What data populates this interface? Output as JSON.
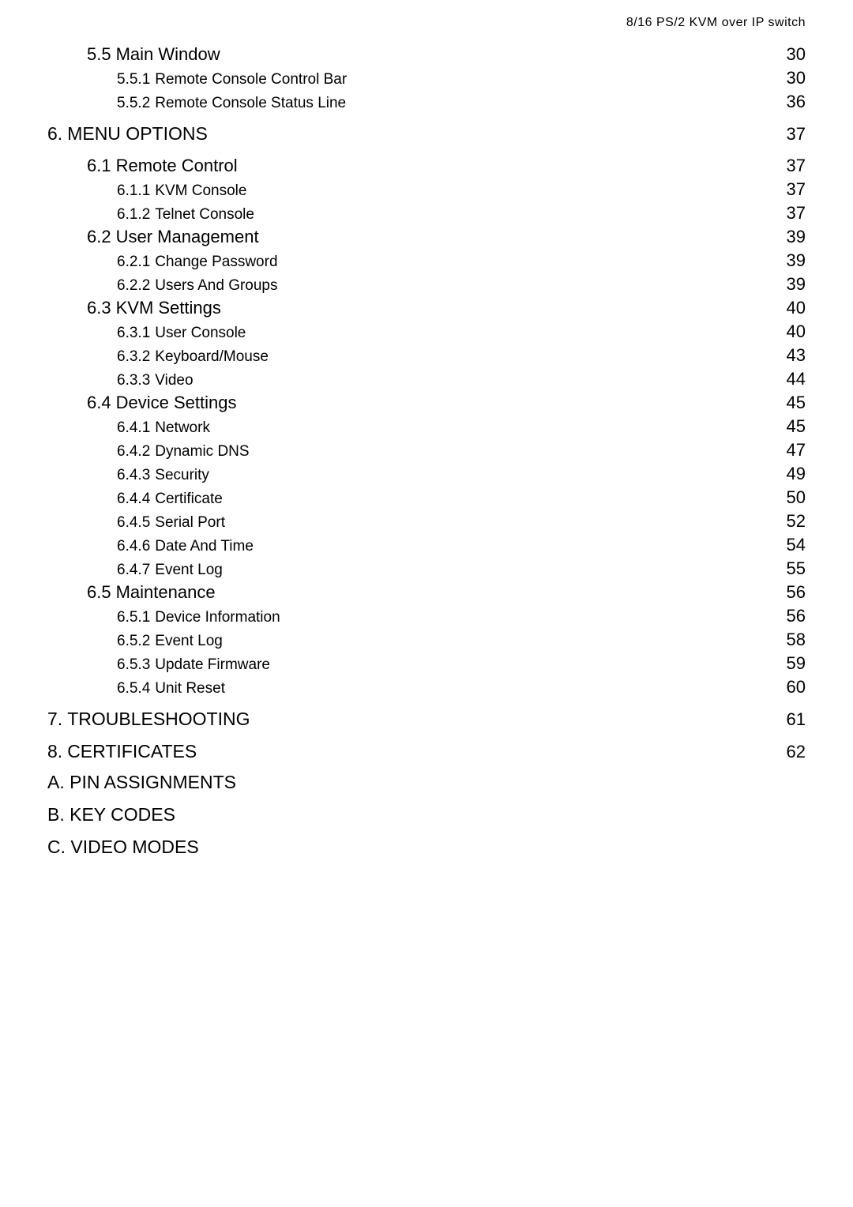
{
  "header": "8/16 PS/2 KVM over IP switch",
  "toc": [
    {
      "level": 1,
      "num": "5.5",
      "title": "Main Window",
      "page": "30"
    },
    {
      "level": 2,
      "num": "5.5.1",
      "title": "Remote Console Control Bar",
      "page": "30"
    },
    {
      "level": 2,
      "num": "5.5.2",
      "title": "Remote Console Status Line",
      "page": "36"
    },
    {
      "gap": true
    },
    {
      "level": 0,
      "num": "6.",
      "title": "MENU OPTIONS",
      "page": "37"
    },
    {
      "gap": true
    },
    {
      "level": 1,
      "num": "6.1",
      "title": "Remote Control",
      "page": "37"
    },
    {
      "level": 2,
      "num": "6.1.1",
      "title": "KVM Console",
      "page": "37"
    },
    {
      "level": 2,
      "num": "6.1.2",
      "title": "Telnet Console",
      "page": "37"
    },
    {
      "level": 1,
      "num": "6.2",
      "title": "User Management",
      "page": "39"
    },
    {
      "level": 2,
      "num": "6.2.1",
      "title": "Change Password",
      "page": "39"
    },
    {
      "level": 2,
      "num": "6.2.2",
      "title": "Users And Groups",
      "page": "39"
    },
    {
      "level": 1,
      "num": "6.3",
      "title": "KVM Settings",
      "page": "40"
    },
    {
      "level": 2,
      "num": "6.3.1",
      "title": "User Console",
      "page": "40"
    },
    {
      "level": 2,
      "num": "6.3.2",
      "title": "Keyboard/Mouse",
      "page": "43"
    },
    {
      "level": 2,
      "num": "6.3.3",
      "title": "Video",
      "page": "44"
    },
    {
      "level": 1,
      "num": "6.4",
      "title": "Device Settings",
      "page": "45"
    },
    {
      "level": 2,
      "num": "6.4.1",
      "title": "Network",
      "page": "45"
    },
    {
      "level": 2,
      "num": "6.4.2",
      "title": "Dynamic DNS",
      "page": "47"
    },
    {
      "level": 2,
      "num": "6.4.3",
      "title": "Security",
      "page": "49"
    },
    {
      "level": 2,
      "num": "6.4.4",
      "title": "Certificate",
      "page": "50"
    },
    {
      "level": 2,
      "num": "6.4.5",
      "title": "Serial Port",
      "page": "52"
    },
    {
      "level": 2,
      "num": "6.4.6",
      "title": "Date And Time",
      "page": "54"
    },
    {
      "level": 2,
      "num": "6.4.7",
      "title": "Event Log",
      "page": "55"
    },
    {
      "level": 1,
      "num": "6.5",
      "title": "Maintenance",
      "page": "56"
    },
    {
      "level": 2,
      "num": "6.5.1",
      "title": "Device Information",
      "page": "56"
    },
    {
      "level": 2,
      "num": "6.5.2",
      "title": "Event Log",
      "page": "58"
    },
    {
      "level": 2,
      "num": "6.5.3",
      "title": "Update Firmware",
      "page": "59"
    },
    {
      "level": 2,
      "num": "6.5.4",
      "title": "Unit Reset",
      "page": "60"
    },
    {
      "gap": true
    },
    {
      "level": 0,
      "num": "7.",
      "title": "TROUBLESHOOTING",
      "page": "61"
    },
    {
      "gap": true
    },
    {
      "level": 0,
      "num": "8.",
      "title": "CERTIFICATES",
      "page": "62"
    }
  ],
  "appendices": [
    "A. PIN ASSIGNMENTS",
    "B. KEY CODES",
    "C. VIDEO MODES"
  ]
}
